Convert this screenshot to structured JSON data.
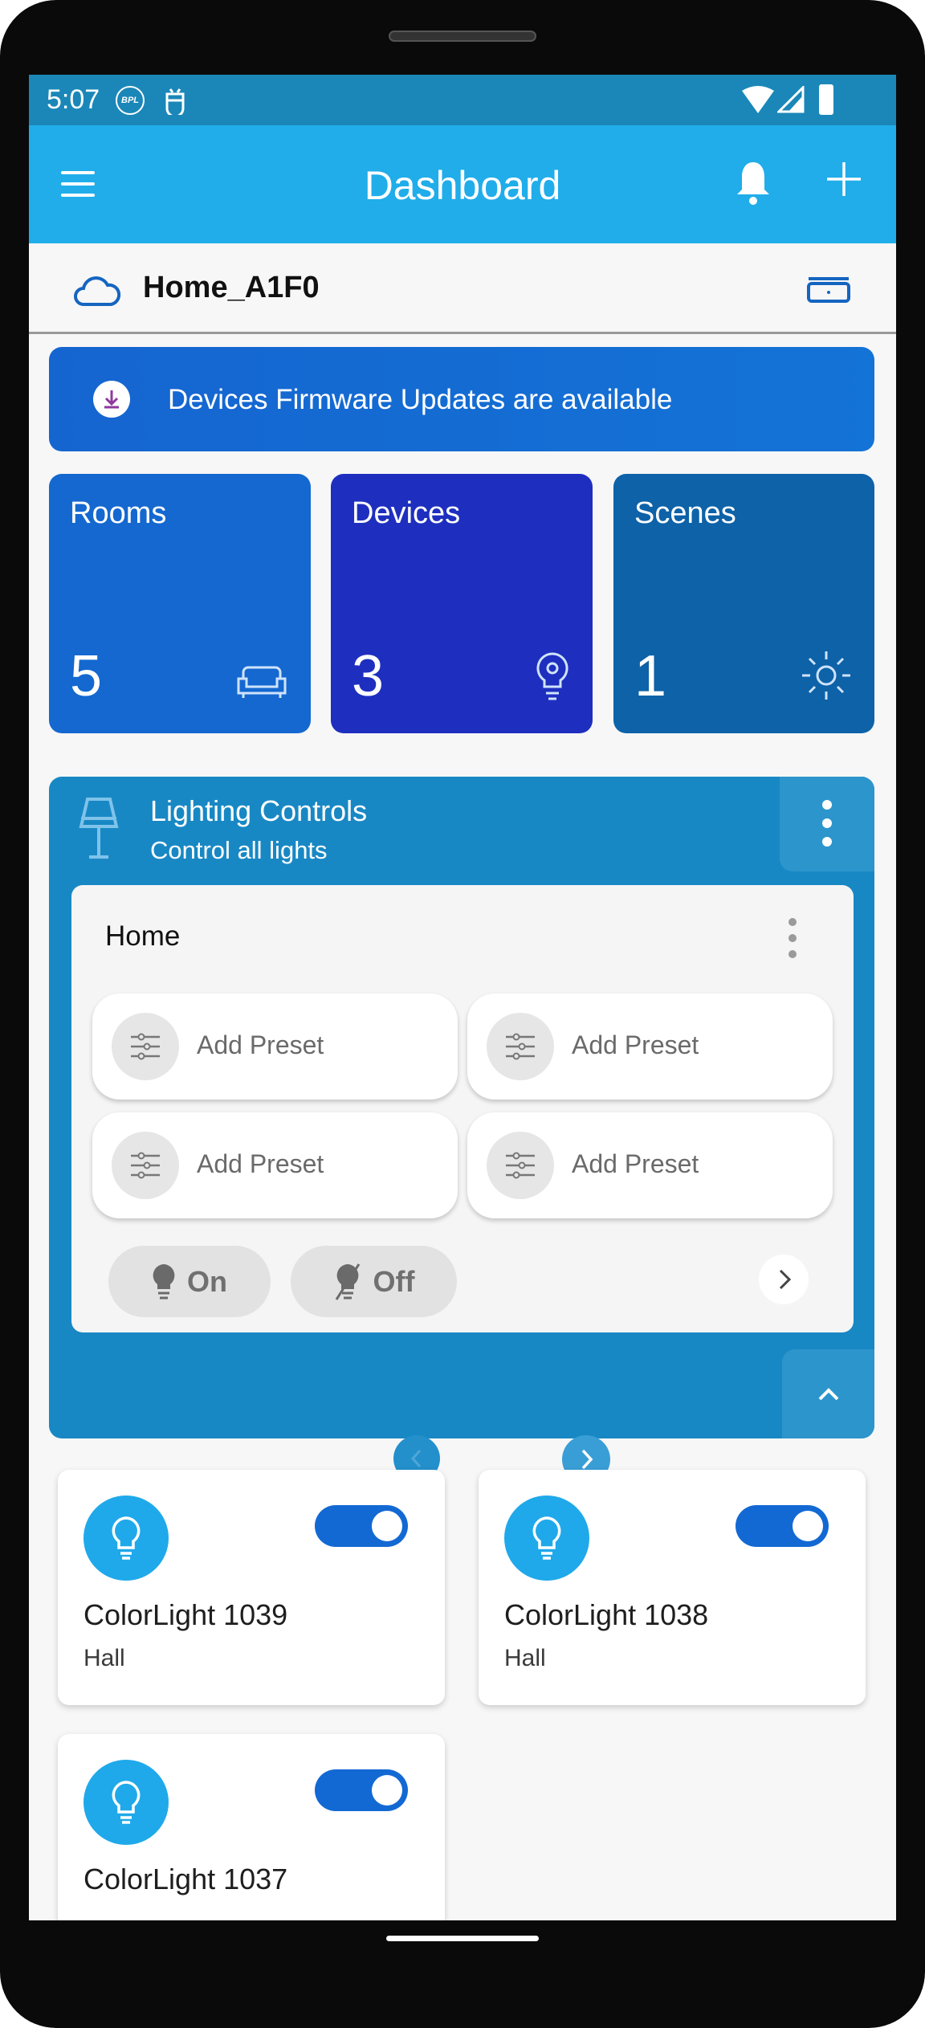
{
  "status_bar": {
    "time": "5:07",
    "badge": "BPL"
  },
  "app_bar": {
    "title": "Dashboard"
  },
  "home": {
    "name": "Home_A1F0"
  },
  "banner": {
    "text": "Devices Firmware Updates are available"
  },
  "tiles": [
    {
      "label": "Rooms",
      "count": "5",
      "color": "#1468d0"
    },
    {
      "label": "Devices",
      "count": "3",
      "color": "#1e2fbf"
    },
    {
      "label": "Scenes",
      "count": "1",
      "color": "#0d62a8"
    }
  ],
  "lighting": {
    "title": "Lighting Controls",
    "subtitle": "Control all lights",
    "group": "Home",
    "presets": [
      "Add Preset",
      "Add Preset",
      "Add Preset",
      "Add Preset"
    ],
    "on_label": "On",
    "off_label": "Off"
  },
  "devices": [
    {
      "name": "ColorLight 1039",
      "room": "Hall",
      "on": true
    },
    {
      "name": "ColorLight 1038",
      "room": "Hall",
      "on": true
    },
    {
      "name": "ColorLight 1037",
      "room": "",
      "on": true
    }
  ]
}
